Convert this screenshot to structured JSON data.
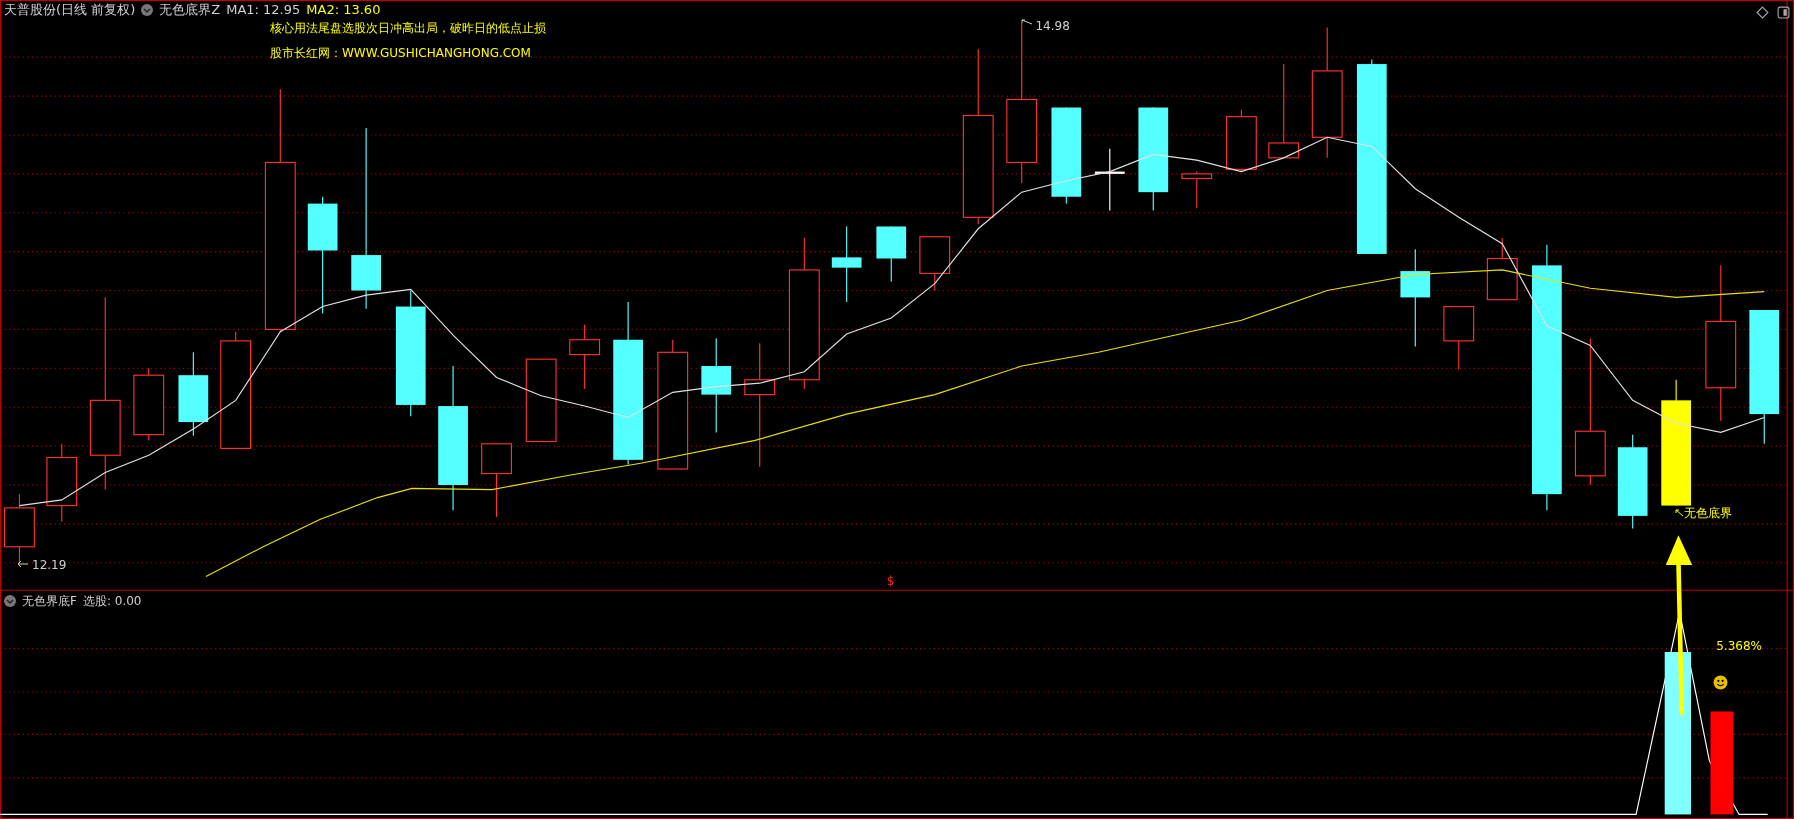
{
  "header": {
    "stock_title": "天普股份(日线 前复权)",
    "indicator": "无色底界Z",
    "ma1": "MA1: 12.95",
    "ma2": "MA2: 13.60"
  },
  "notes": [
    "核心用法尾盘选股次日冲高出局，破昨日的低点止损",
    "股市长红网：WWW.GUSHICHANGHONG.COM"
  ],
  "price_chart": {
    "high_label": "14.98",
    "low_label": "12.19",
    "signal_label": "无色底界",
    "marker": "$"
  },
  "lower_panel": {
    "title": "无色界底F",
    "reading": "选股: 0.00",
    "percent": "5.368%"
  }
}
